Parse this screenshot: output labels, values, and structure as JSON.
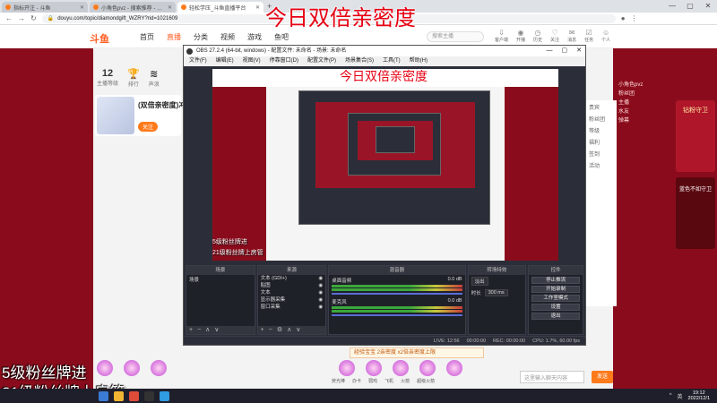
{
  "browser": {
    "tabs": [
      {
        "label": "指标开注 - 斗鱼"
      },
      {
        "label": "小角色pvz - 搜索推荐 - 斗鱼直播"
      },
      {
        "label": "轻松学压_斗鱼直播平台"
      }
    ],
    "url": "douyu.com/topic/diamondgift_WZRY?rid=1021609"
  },
  "site": {
    "logo": "斗鱼",
    "nav": [
      "首页",
      "直播",
      "分类",
      "视频",
      "游戏",
      "鱼吧"
    ],
    "search_placeholder": "搜索主播",
    "header_icons": [
      "客户端",
      "开播",
      "历史",
      "关注",
      "消息",
      "任务",
      "个人"
    ]
  },
  "room": {
    "stats": [
      {
        "num": "12",
        "label": "主播等级"
      },
      {
        "num": "",
        "label": "排行"
      },
      {
        "num": "",
        "label": "声浪"
      }
    ],
    "title": "(双倍亲密度)冲",
    "follow_label": "关注",
    "streamer": "小角色pvz"
  },
  "overlays": {
    "top_text": "今日双倍亲密度",
    "bottom_line1": "5级粉丝牌进",
    "bottom_line2": "21级粉丝牌上房管"
  },
  "obs": {
    "title": "OBS 27.2.4 (64-bit, windows) - 配置文件: 未命名 - 场景: 未命名",
    "menu": [
      "文件(F)",
      "编辑(E)",
      "视图(V)",
      "停靠窗口(D)",
      "配置文件(P)",
      "场景集合(S)",
      "工具(T)",
      "帮助(H)"
    ],
    "inner_top_text": "今日双倍亲密度",
    "inner_bottom_text": "5级粉丝牌进",
    "inner_bottom_text2": "21级粉丝牌上房管",
    "docks": {
      "scenes": {
        "title": "场景",
        "items": [
          "场景"
        ]
      },
      "sources": {
        "title": "来源",
        "items": [
          "文本 (GDI+)",
          "贴图",
          "文本",
          "显示器采集",
          "窗口采集"
        ]
      },
      "mixer": {
        "title": "混音器",
        "rows": [
          {
            "name": "桌面音频",
            "db": "0.0 dB"
          },
          {
            "name": "麦克风",
            "db": "0.0 dB"
          }
        ]
      },
      "transitions": {
        "title": "转场特效",
        "type": "淡出",
        "duration_label": "时长",
        "duration": "300 ms"
      },
      "controls": {
        "title": "控件",
        "buttons": [
          "停止推流",
          "开始录制",
          "工作室模式",
          "设置",
          "退出"
        ]
      }
    },
    "status": [
      "LIVE: 12:56",
      "00:00:00",
      "REC: 00:00:00",
      "CPU: 1.7%, 60.00 fps"
    ]
  },
  "page": {
    "bottom_note": "经验宝宝 2亲密度 x2倍亲密度上限",
    "chat_placeholder": "这里输入聊天内容",
    "send_label": "发送",
    "gift_labels": [
      "荧光棒",
      "办卡",
      "弱鸡",
      "飞机",
      "火箭",
      "超级火箭"
    ],
    "right_panel": [
      "贵宾",
      "粉丝团",
      "等级",
      "福利",
      "签到",
      "活动"
    ],
    "side_chat": [
      "小角色pvz",
      "粉丝团",
      "主播",
      "水友",
      "弹幕"
    ],
    "side_promo": "钻粉守卫",
    "side_promo2": "蓝色不如守卫"
  },
  "taskbar": {
    "time": "19:12",
    "date": "2022/12/1",
    "tray": [
      "^",
      "英"
    ]
  }
}
